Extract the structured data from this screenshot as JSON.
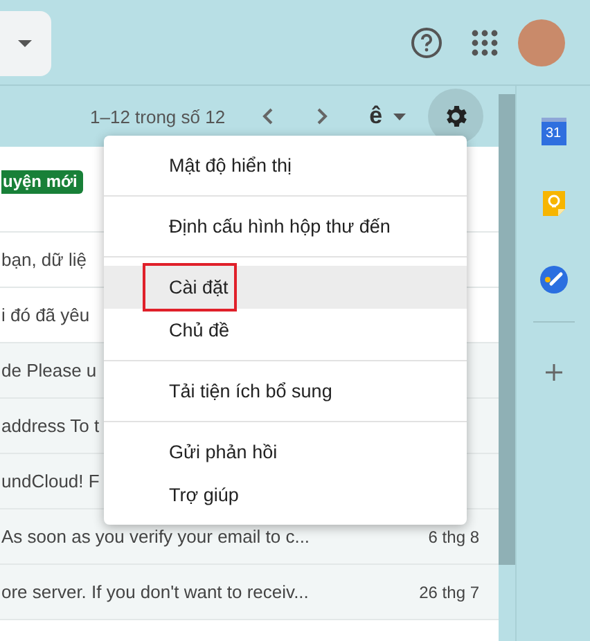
{
  "toolbar": {
    "range": "1–12 trong số 12",
    "input_tool": "ê"
  },
  "side_panel": {
    "calendar_day": "31"
  },
  "emails": [
    {
      "badge": "uyện mới",
      "read": false
    },
    {
      "snippet": "bạn, dữ liệ",
      "read": false
    },
    {
      "snippet": "i đó đã yêu",
      "read": false
    },
    {
      "snippet": "de Please u",
      "read": true
    },
    {
      "snippet": "address To t",
      "read": true
    },
    {
      "snippet": "undCloud! F",
      "read": true
    },
    {
      "snippet": "As soon as you verify your email to c...",
      "date": "6 thg 8",
      "read": true
    },
    {
      "snippet": "ore server. If you don't want to receiv...",
      "date": "26 thg 7",
      "read": true
    }
  ],
  "settings_menu": {
    "groups": [
      [
        {
          "label": "Mật độ hiển thị",
          "highlighted": false
        }
      ],
      [
        {
          "label": "Định cấu hình hộp thư đến",
          "highlighted": false
        }
      ],
      [
        {
          "label": "Cài đặt",
          "highlighted": true
        },
        {
          "label": "Chủ đề",
          "highlighted": false
        }
      ],
      [
        {
          "label": "Tải tiện ích bổ sung",
          "highlighted": false
        }
      ],
      [
        {
          "label": "Gửi phản hồi",
          "highlighted": false
        },
        {
          "label": "Trợ giúp",
          "highlighted": false
        }
      ]
    ]
  }
}
